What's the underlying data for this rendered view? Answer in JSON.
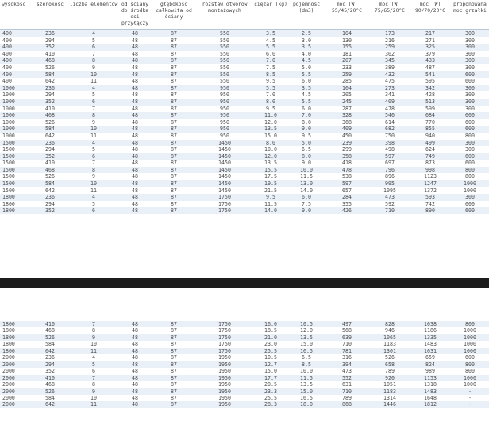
{
  "headers": [
    "wysokość",
    "szerokość",
    "liczba elementów",
    "od ściany do środka osi przyłączy",
    "głębokość całkowita od ściany",
    "rozstaw otworów montażowych",
    "ciężar (kg)",
    "pojemność (dm3)",
    "moc [W] 55/45/20°C",
    "moc [W] 75/65/20°C",
    "moc [W] 90/70/20°C",
    "proponowana moc grzałki"
  ],
  "rows_top": [
    [
      "400",
      "236",
      "4",
      "48",
      "87",
      "550",
      "3.5",
      "2.5",
      "104",
      "173",
      "217",
      "300"
    ],
    [
      "400",
      "294",
      "5",
      "48",
      "87",
      "550",
      "4.5",
      "3.0",
      "130",
      "216",
      "271",
      "300"
    ],
    [
      "400",
      "352",
      "6",
      "48",
      "87",
      "550",
      "5.5",
      "3.5",
      "155",
      "259",
      "325",
      "300"
    ],
    [
      "400",
      "410",
      "7",
      "48",
      "87",
      "550",
      "6.0",
      "4.0",
      "181",
      "302",
      "379",
      "300"
    ],
    [
      "400",
      "468",
      "8",
      "48",
      "87",
      "550",
      "7.0",
      "4.5",
      "207",
      "345",
      "433",
      "300"
    ],
    [
      "400",
      "526",
      "9",
      "48",
      "87",
      "550",
      "7.5",
      "5.0",
      "233",
      "389",
      "487",
      "300"
    ],
    [
      "400",
      "584",
      "10",
      "48",
      "87",
      "550",
      "8.5",
      "5.5",
      "259",
      "432",
      "541",
      "600"
    ],
    [
      "400",
      "642",
      "11",
      "48",
      "87",
      "550",
      "9.5",
      "6.0",
      "285",
      "475",
      "595",
      "600"
    ],
    [
      "1000",
      "236",
      "4",
      "48",
      "87",
      "950",
      "5.5",
      "3.5",
      "164",
      "273",
      "342",
      "300"
    ],
    [
      "1000",
      "294",
      "5",
      "48",
      "87",
      "950",
      "7.0",
      "4.5",
      "205",
      "341",
      "428",
      "300"
    ],
    [
      "1000",
      "352",
      "6",
      "48",
      "87",
      "950",
      "8.0",
      "5.5",
      "245",
      "409",
      "513",
      "300"
    ],
    [
      "1000",
      "410",
      "7",
      "48",
      "87",
      "950",
      "9.5",
      "6.0",
      "287",
      "478",
      "599",
      "300"
    ],
    [
      "1000",
      "468",
      "8",
      "48",
      "87",
      "950",
      "11.0",
      "7.0",
      "328",
      "546",
      "684",
      "600"
    ],
    [
      "1000",
      "526",
      "9",
      "48",
      "87",
      "950",
      "12.0",
      "8.0",
      "368",
      "614",
      "770",
      "600"
    ],
    [
      "1000",
      "584",
      "10",
      "48",
      "87",
      "950",
      "13.5",
      "9.0",
      "409",
      "682",
      "855",
      "600"
    ],
    [
      "1000",
      "642",
      "11",
      "48",
      "87",
      "950",
      "15.0",
      "9.5",
      "450",
      "750",
      "940",
      "800"
    ],
    [
      "1500",
      "236",
      "4",
      "48",
      "87",
      "1450",
      "8.0",
      "5.0",
      "239",
      "398",
      "499",
      "300"
    ],
    [
      "1500",
      "294",
      "5",
      "48",
      "87",
      "1450",
      "10.0",
      "6.5",
      "299",
      "498",
      "624",
      "300"
    ],
    [
      "1500",
      "352",
      "6",
      "48",
      "87",
      "1450",
      "12.0",
      "8.0",
      "358",
      "597",
      "749",
      "600"
    ],
    [
      "1500",
      "410",
      "7",
      "48",
      "87",
      "1450",
      "13.5",
      "9.0",
      "418",
      "697",
      "873",
      "600"
    ],
    [
      "1500",
      "468",
      "8",
      "48",
      "87",
      "1450",
      "15.5",
      "10.0",
      "478",
      "796",
      "998",
      "800"
    ],
    [
      "1500",
      "526",
      "9",
      "48",
      "87",
      "1450",
      "17.5",
      "11.5",
      "538",
      "896",
      "1123",
      "800"
    ],
    [
      "1500",
      "584",
      "10",
      "48",
      "87",
      "1450",
      "19.5",
      "13.0",
      "597",
      "995",
      "1247",
      "1000"
    ],
    [
      "1500",
      "642",
      "11",
      "48",
      "87",
      "1450",
      "21.5",
      "14.0",
      "657",
      "1095",
      "1372",
      "1000"
    ],
    [
      "1800",
      "236",
      "4",
      "48",
      "87",
      "1750",
      "9.5",
      "6.0",
      "284",
      "473",
      "593",
      "300"
    ],
    [
      "1800",
      "294",
      "5",
      "48",
      "87",
      "1750",
      "11.5",
      "7.5",
      "355",
      "592",
      "742",
      "600"
    ],
    [
      "1800",
      "352",
      "6",
      "48",
      "87",
      "1750",
      "14.0",
      "9.0",
      "426",
      "710",
      "890",
      "600"
    ]
  ],
  "rows_bottom": [
    [
      "1800",
      "410",
      "7",
      "48",
      "87",
      "1750",
      "16.0",
      "10.5",
      "497",
      "828",
      "1038",
      "800"
    ],
    [
      "1800",
      "468",
      "8",
      "48",
      "87",
      "1750",
      "18.5",
      "12.0",
      "568",
      "946",
      "1186",
      "1000"
    ],
    [
      "1800",
      "526",
      "9",
      "48",
      "87",
      "1750",
      "21.0",
      "13.5",
      "639",
      "1065",
      "1335",
      "1000"
    ],
    [
      "1800",
      "584",
      "10",
      "48",
      "87",
      "1750",
      "23.0",
      "15.0",
      "710",
      "1183",
      "1483",
      "1000"
    ],
    [
      "1800",
      "642",
      "11",
      "48",
      "87",
      "1750",
      "25.5",
      "16.5",
      "781",
      "1301",
      "1631",
      "1000"
    ],
    [
      "2000",
      "236",
      "4",
      "48",
      "87",
      "1950",
      "10.5",
      "6.5",
      "316",
      "526",
      "659",
      "600"
    ],
    [
      "2000",
      "294",
      "5",
      "48",
      "87",
      "1950",
      "12.7",
      "8.5",
      "394",
      "658",
      "824",
      "800"
    ],
    [
      "2000",
      "352",
      "6",
      "48",
      "87",
      "1950",
      "15.0",
      "10.0",
      "473",
      "789",
      "989",
      "800"
    ],
    [
      "2000",
      "410",
      "7",
      "48",
      "87",
      "1950",
      "17.7",
      "11.5",
      "552",
      "920",
      "1153",
      "1000"
    ],
    [
      "2000",
      "468",
      "8",
      "48",
      "87",
      "1950",
      "20.5",
      "13.5",
      "631",
      "1051",
      "1318",
      "1000"
    ],
    [
      "2000",
      "526",
      "9",
      "48",
      "87",
      "1950",
      "23.3",
      "15.0",
      "710",
      "1183",
      "1483",
      "-"
    ],
    [
      "2000",
      "584",
      "10",
      "48",
      "87",
      "1950",
      "25.5",
      "16.5",
      "789",
      "1314",
      "1648",
      "-"
    ],
    [
      "2000",
      "642",
      "11",
      "48",
      "87",
      "1950",
      "28.3",
      "18.0",
      "868",
      "1446",
      "1812",
      "-"
    ]
  ]
}
